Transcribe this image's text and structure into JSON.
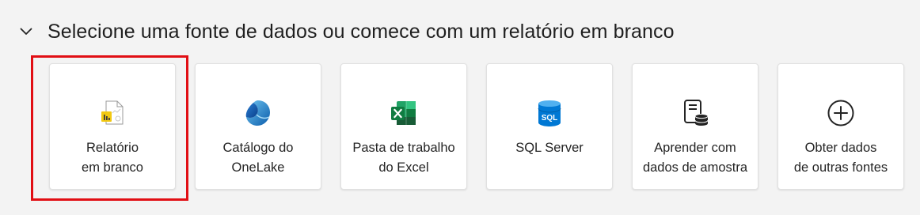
{
  "section": {
    "title": "Selecione uma fonte de dados ou comece com um relatório em branco",
    "chevron_icon": "chevron-down-icon"
  },
  "cards": [
    {
      "icon": "blank-report-icon",
      "line1": "Relatório",
      "line2": "em branco"
    },
    {
      "icon": "onelake-catalog-icon",
      "line1": "Catálogo do",
      "line2": "OneLake"
    },
    {
      "icon": "excel-icon",
      "line1": "Pasta de trabalho",
      "line2": "do Excel"
    },
    {
      "icon": "sql-server-icon",
      "line1": "SQL Server",
      "line2": ""
    },
    {
      "icon": "sample-data-icon",
      "line1": "Aprender com",
      "line2": "dados de amostra"
    },
    {
      "icon": "add-circle-icon",
      "line1": "Obter dados",
      "line2": "de outras fontes"
    }
  ],
  "colors": {
    "highlight": "#e10e14",
    "powerbi_yellow": "#f2c811",
    "excel_green": "#107c41",
    "sql_blue": "#0078d4",
    "onelake_blue": "#0f6cbd"
  }
}
